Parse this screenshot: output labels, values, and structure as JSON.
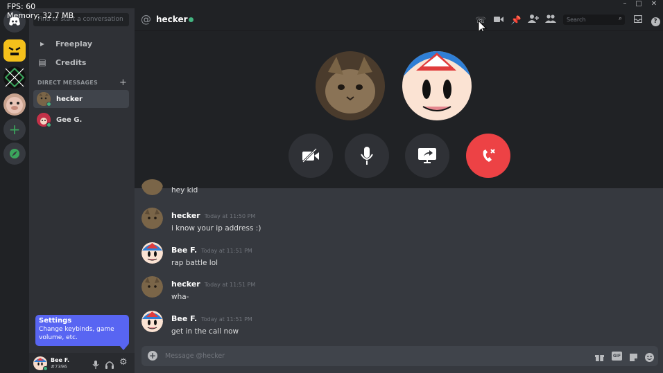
{
  "overlay": {
    "fps": "FPS: 60",
    "memory": "Memory: 32.7 MB"
  },
  "window_controls": [
    "–",
    "□",
    "✕"
  ],
  "sidebar": {
    "search_placeholder": "Find or start a conversation",
    "nav": [
      {
        "label": "Freeplay",
        "icon": "freeplay-icon"
      },
      {
        "label": "Credits",
        "icon": "credits-icon"
      }
    ],
    "dm_header": "DIRECT MESSAGES",
    "dms": [
      {
        "name": "hecker",
        "active": true
      },
      {
        "name": "Gee G.",
        "active": false
      }
    ]
  },
  "tooltip": {
    "title": "Settings",
    "body": "Change keybinds, game volume, etc."
  },
  "user": {
    "name": "Bee F.",
    "tag": "#7396"
  },
  "header": {
    "at": "@",
    "channel": "hecker",
    "search_placeholder": "Search"
  },
  "messages": [
    {
      "author": "",
      "time": "",
      "text": "hey kid",
      "avatar": "cat"
    },
    {
      "author": "hecker",
      "time": "Today at 11:50 PM",
      "text": "i know your ip address :)",
      "avatar": "cat"
    },
    {
      "author": "Bee F.",
      "time": "Today at 11:51 PM",
      "text": "rap battle lol",
      "avatar": "bee"
    },
    {
      "author": "hecker",
      "time": "Today at 11:51 PM",
      "text": "wha-",
      "avatar": "cat"
    },
    {
      "author": "Bee F.",
      "time": "Today at 11:51 PM",
      "text": "get in the call now",
      "avatar": "bee"
    }
  ],
  "composer": {
    "placeholder": "Message @hecker"
  },
  "colors": {
    "online": "#43b581",
    "hangup": "#ed4245",
    "blurple": "#5865f2"
  }
}
